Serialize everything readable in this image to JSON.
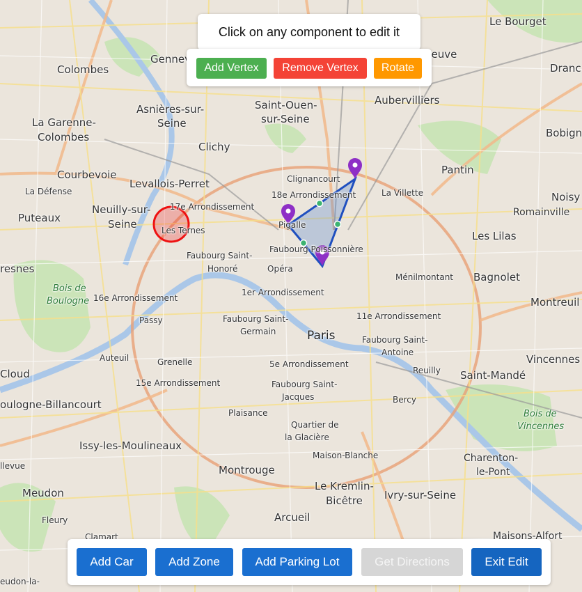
{
  "hint": {
    "text": "Click on any component to edit it"
  },
  "edit_toolbar": {
    "add_vertex": "Add Vertex",
    "remove_vertex": "Remove Vertex",
    "rotate": "Rotate"
  },
  "bottom_bar": {
    "add_car": "Add Car",
    "add_zone": "Add Zone",
    "add_parking_lot": "Add Parking Lot",
    "get_directions": "Get Directions",
    "exit_edit": "Exit Edit"
  },
  "colors": {
    "green": "#4caf50",
    "red": "#f44336",
    "orange": "#ff9800",
    "blue": "#1a6fd0",
    "disabled": "#d6d6d6",
    "exit": "#1565c0",
    "polygon_stroke": "#1f4fbf",
    "marker": "#8e2fc6",
    "circle": "#ee1111"
  },
  "map_labels": {
    "le_bourget": "Le Bourget",
    "colombes": "Colombes",
    "gennevilliers": "Gennev",
    "asnieres": "Asnières-sur-",
    "asnieres2": "Seine",
    "saint_ouen": "Saint-Ouen-",
    "saint_ouen2": "sur-Seine",
    "aubervilliers": "Aubervilliers",
    "drancy": "Dranc",
    "bobigny": "Bobign",
    "la_garenne": "La Garenne-",
    "la_garenne2": "Colombes",
    "clichy": "Clichy",
    "courbevoie": "Courbevoie",
    "levallois": "Levallois-Perret",
    "clignancourt": "Clignancourt",
    "pantin": "Pantin",
    "noisy": "Noisy",
    "la_defense": "La Défense",
    "arr18": "18e Arrondissement",
    "la_villette": "La Villette",
    "neuilly": "Neuilly-sur-",
    "neuilly2": "Seine",
    "arr17": "17e Arrondissement",
    "romainville": "Romainville",
    "puteaux": "Puteaux",
    "les_ternes": "Les Ternes",
    "pigalle": "Pigalle",
    "les_lilas": "Les Lilas",
    "faubourg_poissonniere": "Faubourg Poissonnière",
    "faubourg_st_honore": "Faubourg Saint-",
    "faubourg_st_honore2": "Honoré",
    "opera": "Opéra",
    "suresnes": "resnes",
    "menilmontant": "Ménilmontant",
    "bagnolet": "Bagnolet",
    "bois_boulogne": "Bois de",
    "bois_boulogne2": "Boulogne",
    "arr16": "16e Arrondissement",
    "arr1": "1er Arrondissement",
    "montreuil": "Montreuil",
    "passy": "Passy",
    "faubourg_st_germain": "Faubourg Saint-",
    "faubourg_st_germain2": "Germain",
    "arr11": "11e Arrondissement",
    "paris": "Paris",
    "faubourg_st_antoine": "Faubourg Saint-",
    "faubourg_st_antoine2": "Antoine",
    "auteuil": "Auteuil",
    "vincennes": "Vincennes",
    "grenelle": "Grenelle",
    "arr5": "5e Arrondissement",
    "reuilly": "Reuilly",
    "cloud": "Cloud",
    "saint_mande": "Saint-Mandé",
    "arr15": "15e Arrondissement",
    "faubourg_st_jacques": "Faubourg Saint-",
    "faubourg_st_jacques2": "Jacques",
    "bercy": "Bercy",
    "boulogne": "oulogne-Billancourt",
    "bois_vincennes": "Bois de",
    "bois_vincennes2": "Vincennes",
    "plaisance": "Plaisance",
    "quartier_glaciere": "Quartier de",
    "quartier_glaciere2": "la Glacière",
    "issy": "Issy-les-Moulineaux",
    "charenton": "Charenton-",
    "charenton2": "le-Pont",
    "maison_blanche": "Maison-Blanche",
    "meudon": "Meudon",
    "montrouge": "Montrouge",
    "le_kremlin": "Le Kremlin-",
    "le_kremlin2": "Bicêtre",
    "ivry": "Ivry-sur-Seine",
    "fleury": "Fleury",
    "arcueil": "Arcueil",
    "maisons_alfort": "Maisons-Alfort",
    "clamart": "Clamart",
    "meudon_la": "eudon-la-",
    "bellevue": "llevue",
    "neuve": "neuve"
  }
}
